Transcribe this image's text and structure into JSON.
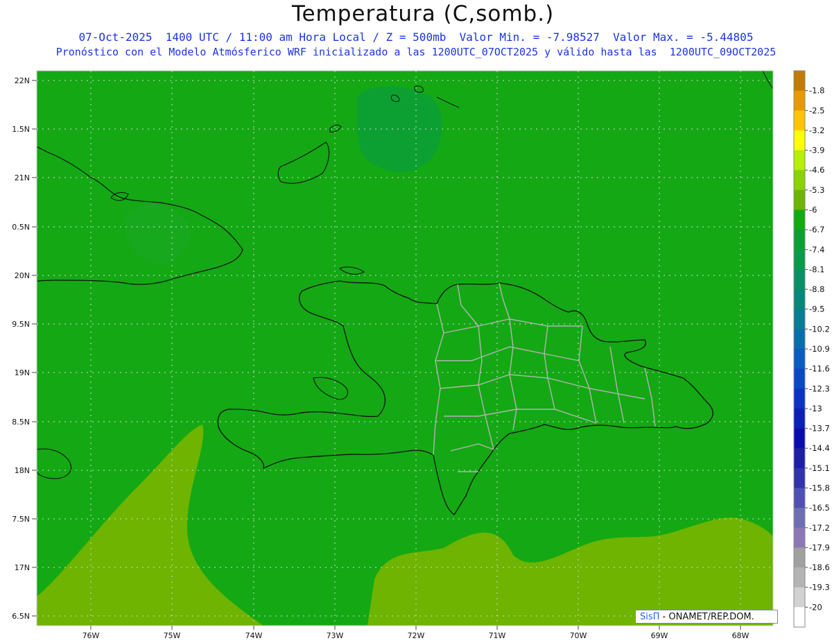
{
  "title": "Temperatura (C,somb.)",
  "subtitle_1": "07-Oct-2025  1400 UTC / 11:00 am Hora Local / Z = 500mb  Valor Min. = -7.98527  Valor Max. = -5.44805",
  "subtitle_2": "Pronóstico con el Modelo Atmósferico WRF inicializado a las 1200UTC_07OCT2025 y válido hasta las  1200UTC_09OCT2025",
  "latitude_labels": [
    "22N",
    "1.5N",
    "21N",
    "0.5N",
    "20N",
    "9.5N",
    "19N",
    "8.5N",
    "18N",
    "7.5N",
    "17N",
    "6.5N"
  ],
  "longitude_labels": [
    "76W",
    "75W",
    "74W",
    "73W",
    "72W",
    "71W",
    "70W",
    "69W",
    "68W"
  ],
  "colorbar": [
    {
      "label": "-1.8",
      "color": "#c07d00"
    },
    {
      "label": "-2.5",
      "color": "#e69a00"
    },
    {
      "label": "-3.2",
      "color": "#ffc600"
    },
    {
      "label": "-3.9",
      "color": "#ffff00"
    },
    {
      "label": "-4.6",
      "color": "#b4f000"
    },
    {
      "label": "-5.3",
      "color": "#8cd200"
    },
    {
      "label": "-6",
      "color": "#6eb400"
    },
    {
      "label": "-6.7",
      "color": "#14aa14"
    },
    {
      "label": "-7.4",
      "color": "#0ca034"
    },
    {
      "label": "-8.1",
      "color": "#0a9a4c"
    },
    {
      "label": "-8.8",
      "color": "#089064"
    },
    {
      "label": "-9.5",
      "color": "#06877c"
    },
    {
      "label": "-10.2",
      "color": "#0a7c94"
    },
    {
      "label": "-10.9",
      "color": "#0a6eaa"
    },
    {
      "label": "-11.6",
      "color": "#0a5cbe"
    },
    {
      "label": "-12.3",
      "color": "#0a48c8"
    },
    {
      "label": "-13",
      "color": "#0a32c8"
    },
    {
      "label": "-13.7",
      "color": "#0a1ebe"
    },
    {
      "label": "-14.4",
      "color": "#0a0ab4"
    },
    {
      "label": "-15.1",
      "color": "#1e1eaa"
    },
    {
      "label": "-15.8",
      "color": "#3232aa"
    },
    {
      "label": "-16.5",
      "color": "#5050b4"
    },
    {
      "label": "-17.2",
      "color": "#6e6eb4"
    },
    {
      "label": "-17.9",
      "color": "#8c78b4"
    },
    {
      "label": "-18.6",
      "color": "#a0a0a0"
    },
    {
      "label": "-19.3",
      "color": "#b4b4b4"
    },
    {
      "label": "-20",
      "color": "#d2d2d2"
    },
    {
      "label": "",
      "color": "#ffffff"
    }
  ],
  "fill_colors": {
    "main": "#14a814",
    "light": "#6eb400",
    "dark": "#0a9e3c"
  },
  "credit": {
    "sis": "SisΠ",
    "rest": " - ONAMET/REP.DOM."
  }
}
